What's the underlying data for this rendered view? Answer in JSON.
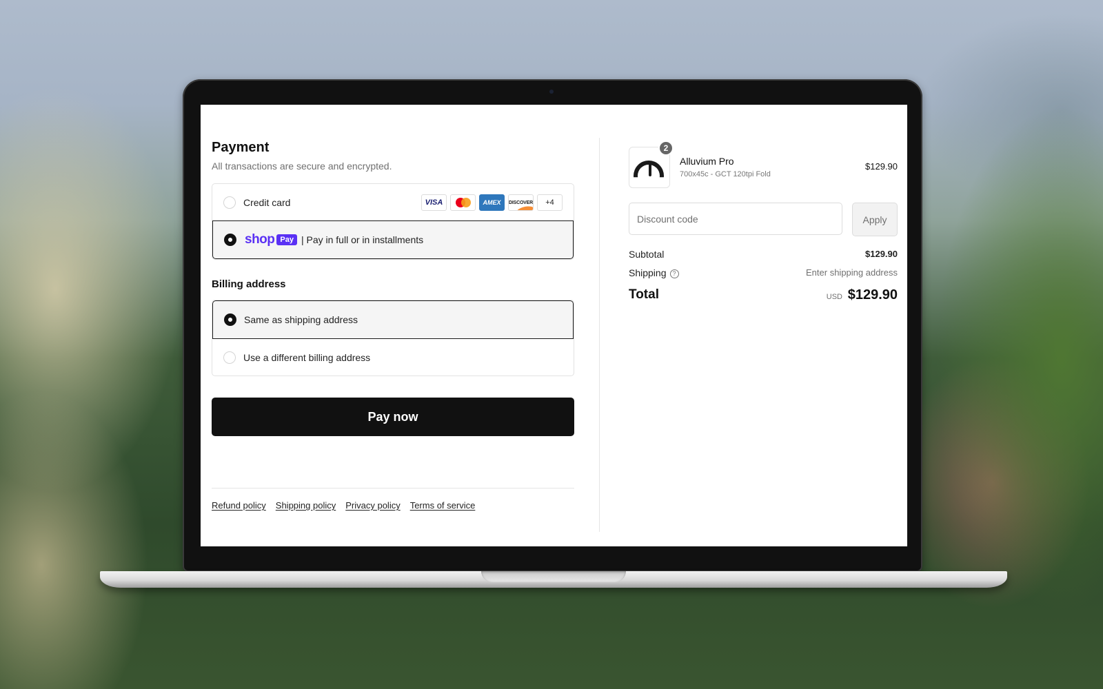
{
  "payment": {
    "title": "Payment",
    "subtitle": "All transactions are secure and encrypted.",
    "options": [
      {
        "label": "Credit card",
        "selected": false
      },
      {
        "label": "| Pay in full or in installments",
        "selected": true
      }
    ],
    "cards": [
      "VISA",
      "mastercard",
      "AMEX",
      "DISCOVER",
      "+4"
    ],
    "shop_pay": {
      "brand": "shop",
      "badge": "Pay"
    }
  },
  "billing": {
    "title": "Billing address",
    "options": [
      {
        "label": "Same as shipping address",
        "selected": true
      },
      {
        "label": "Use a different billing address",
        "selected": false
      }
    ]
  },
  "pay_now_label": "Pay now",
  "footer": {
    "links": [
      "Refund policy",
      "Shipping policy",
      "Privacy policy",
      "Terms of service"
    ]
  },
  "order": {
    "product": {
      "name": "Alluvium Pro",
      "variant": "700x45c - GCT 120tpi Fold",
      "price": "$129.90",
      "quantity": "2"
    },
    "discount": {
      "placeholder": "Discount code",
      "apply_label": "Apply"
    },
    "subtotal": {
      "label": "Subtotal",
      "value": "$129.90"
    },
    "shipping": {
      "label": "Shipping",
      "value": "Enter shipping address"
    },
    "total": {
      "label": "Total",
      "currency": "USD",
      "value": "$129.90"
    }
  },
  "colors": {
    "primary_button": "#111111",
    "shop_pay": "#5a31f4",
    "selected_bg": "#f5f5f5"
  }
}
